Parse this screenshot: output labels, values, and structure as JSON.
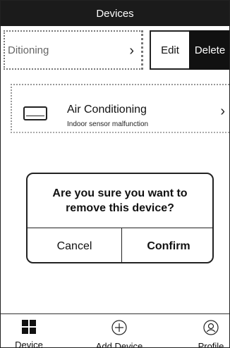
{
  "header": {
    "title": "Devices"
  },
  "device_list": {
    "swiped_row": {
      "label": "Ditioning",
      "edit_label": "Edit",
      "delete_label": "Delete"
    },
    "items": [
      {
        "name": "Air Conditioning",
        "status": "Indoor sensor malfunction",
        "icon": "air-conditioner-icon"
      }
    ]
  },
  "dialog": {
    "message": "Are you sure you want to remove this device?",
    "cancel_label": "Cancel",
    "confirm_label": "Confirm"
  },
  "bottom_nav": {
    "items": [
      {
        "label": "Device",
        "icon": "grid-icon"
      },
      {
        "label": "Add Device",
        "icon": "add-circle-icon"
      },
      {
        "label": "Profile",
        "icon": "profile-icon"
      }
    ]
  }
}
